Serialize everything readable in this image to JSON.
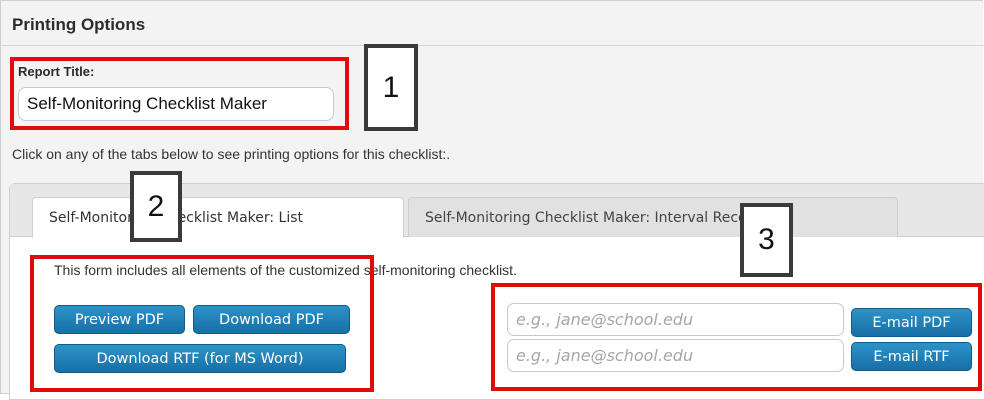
{
  "section": {
    "heading": "Printing Options",
    "report_title_label": "Report Title:",
    "report_title_value": "Self-Monitoring Checklist Maker",
    "instructions": "Click on any of the tabs below to see printing options for this checklist:."
  },
  "tabs": [
    {
      "label": "Self-Monitoring Checklist Maker: List",
      "active": true
    },
    {
      "label": "Self-Monitoring Checklist Maker: Interval Recording",
      "active": false
    }
  ],
  "list_tab": {
    "description": "This form includes all elements of the customized self-monitoring checklist.",
    "preview_pdf_label": "Preview PDF",
    "download_pdf_label": "Download PDF",
    "download_rtf_label": "Download RTF (for MS Word)",
    "email_placeholder_1": "e.g., jane@school.edu",
    "email_placeholder_2": "e.g., jane@school.edu",
    "email_pdf_label": "E-mail PDF",
    "email_rtf_label": "E-mail RTF"
  },
  "callouts": {
    "one": "1",
    "two": "2",
    "three": "3"
  },
  "colors": {
    "highlight": "#e10b0b",
    "button": "#1f80b8"
  }
}
